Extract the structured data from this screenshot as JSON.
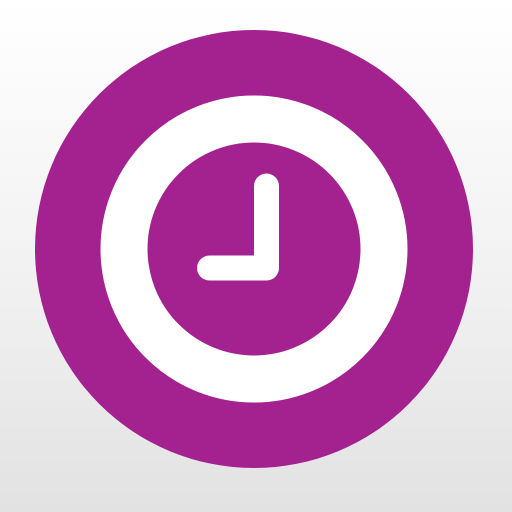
{
  "icon": {
    "name": "clock-icon",
    "colors": {
      "badge": "#a3228f",
      "glyph": "#ffffff",
      "background_top": "#ffffff",
      "background_bottom": "#e2e2e2"
    },
    "hands": {
      "hour": "9",
      "minute": "12"
    }
  }
}
